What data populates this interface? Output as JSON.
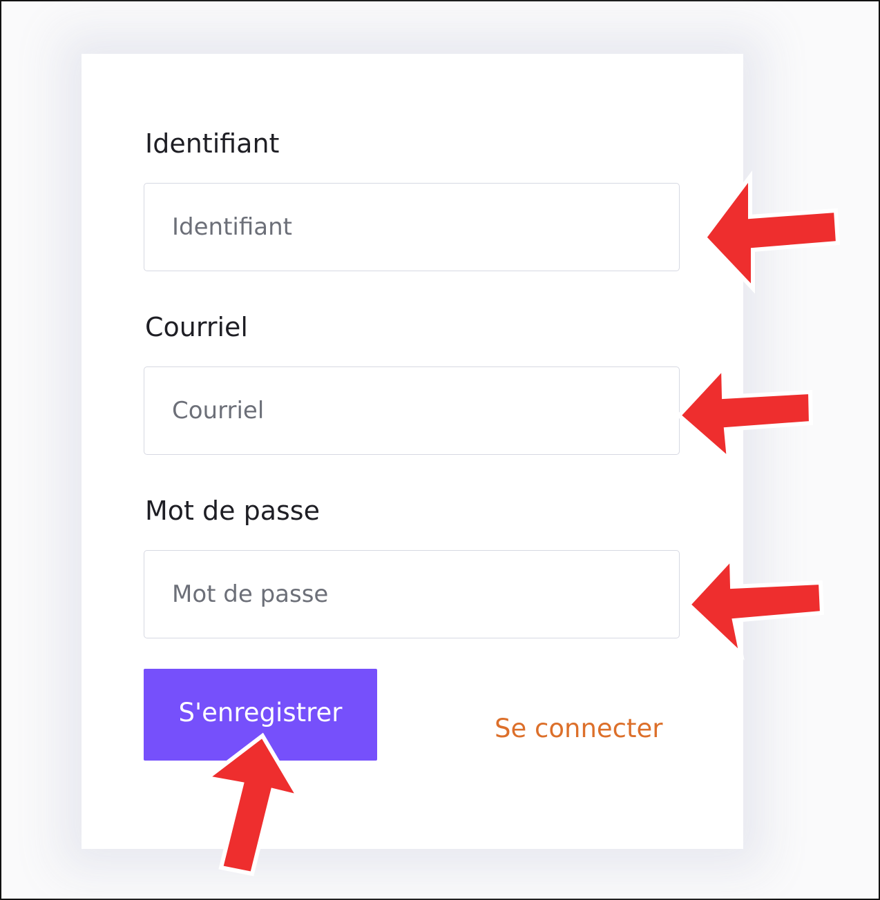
{
  "form": {
    "username": {
      "label": "Identifiant",
      "placeholder": "Identifiant",
      "value": ""
    },
    "email": {
      "label": "Courriel",
      "placeholder": "Courriel",
      "value": ""
    },
    "password": {
      "label": "Mot de passe",
      "placeholder": "Mot de passe",
      "value": ""
    },
    "register_button": "S'enregistrer",
    "login_link": "Se connecter"
  },
  "annotations": {
    "arrow_color": "#ee2e2e",
    "arrows": [
      "arrow-to-username-field",
      "arrow-to-email-field",
      "arrow-to-password-field",
      "arrow-to-register-button"
    ]
  },
  "colors": {
    "button_bg": "#7650fb",
    "link": "#dc6f2a"
  }
}
